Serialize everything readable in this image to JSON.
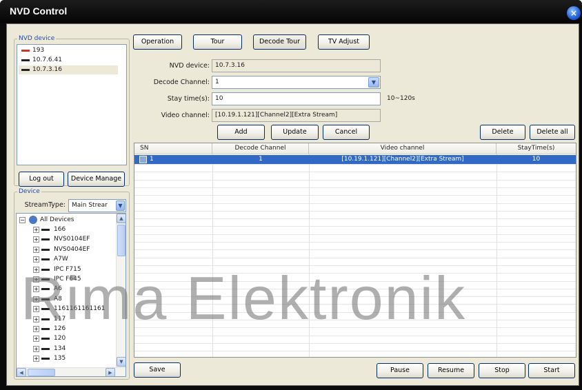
{
  "window": {
    "title": "NVD Control",
    "close_label": "×"
  },
  "nvd_device": {
    "legend": "NVD device",
    "items": [
      "193",
      "10.7.6.41",
      "10.7.3.16"
    ],
    "logout_label": "Log out",
    "device_manage_label": "Device Manage"
  },
  "device": {
    "legend": "Device",
    "stream_type_label": "StreamType:",
    "stream_type_value": "Main Strear",
    "tree": {
      "root": "All Devices",
      "items": [
        "166",
        "NVS0104EF",
        "NVS0404EF",
        "A7W",
        "IPC F715",
        "IPC F645",
        "A6",
        "A8",
        "1161161161161",
        "117",
        "126",
        "120",
        "134",
        "135"
      ]
    }
  },
  "tabs": {
    "operation": "Operation",
    "tour": "Tour",
    "decode_tour": "Decode Tour",
    "tv_adjust": "TV Adjust"
  },
  "form": {
    "nvd_device_label": "NVD device:",
    "nvd_device_value": "10.7.3.16",
    "decode_channel_label": "Decode Channel:",
    "decode_channel_value": "1",
    "stay_time_label": "Stay time(s):",
    "stay_time_value": "10",
    "stay_time_hint": "10~120s",
    "video_channel_label": "Video channel:",
    "video_channel_value": "[10.19.1.121][Channel2][Extra Stream]"
  },
  "actions": {
    "add": "Add",
    "update": "Update",
    "cancel": "Cancel",
    "delete": "Delete",
    "delete_all": "Delete all"
  },
  "table": {
    "headers": [
      "SN",
      "Decode Channel",
      "Video channel",
      "StayTime(s)"
    ],
    "rows": [
      {
        "sn": "1",
        "decode_channel": "1",
        "video_channel": "[10.19.1.121][Channel2][Extra Stream]",
        "stay_time": "10"
      }
    ]
  },
  "bottom": {
    "save": "Save",
    "pause": "Pause",
    "resume": "Resume",
    "stop": "Stop",
    "start": "Start"
  },
  "watermark": "Rima Elektronik",
  "colors": {
    "selection": "#316ac5",
    "title_bar": "#0a0a0a",
    "panel": "#ece9d8",
    "legend": "#2049a8"
  }
}
